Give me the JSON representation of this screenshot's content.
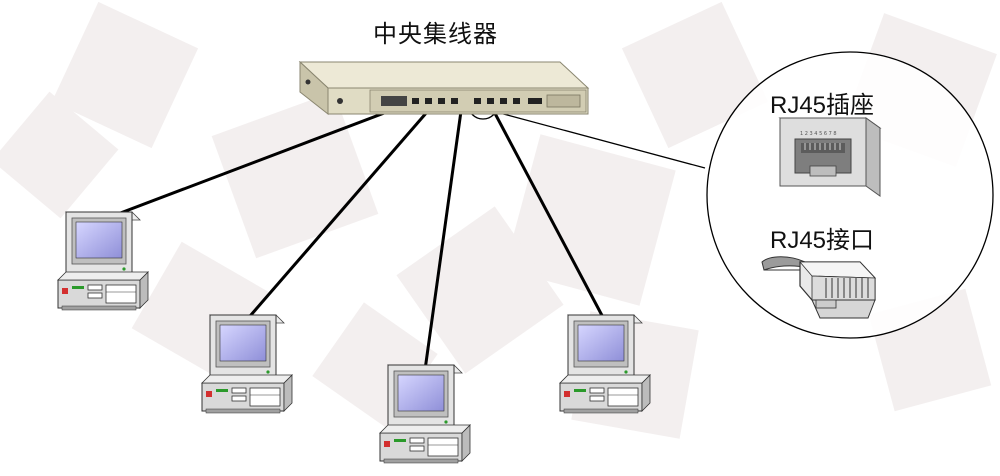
{
  "diagram": {
    "hub_label": "中央集线器",
    "socket_label": "RJ45插座",
    "plug_label": "RJ45接口",
    "socket_pin_numbers": "1 2 3 4 5 6 7 8",
    "computer_count": 4
  },
  "colors": {
    "line": "#000000",
    "hub_body": "#e6e2cc",
    "screen": "#9f9fe6",
    "case": "#d9d9d9",
    "background_shapes": "#e9e2e2"
  }
}
